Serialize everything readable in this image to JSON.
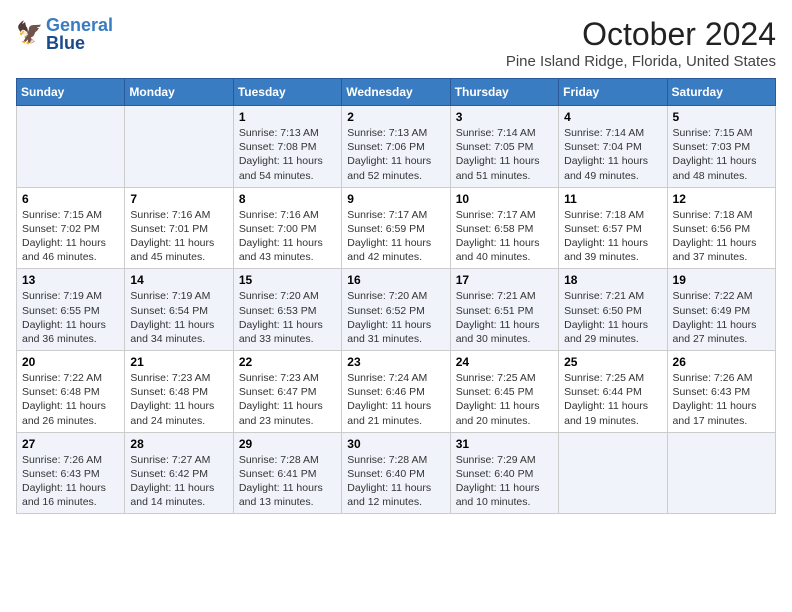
{
  "header": {
    "logo_general": "General",
    "logo_blue": "Blue",
    "month_title": "October 2024",
    "location": "Pine Island Ridge, Florida, United States"
  },
  "days_of_week": [
    "Sunday",
    "Monday",
    "Tuesday",
    "Wednesday",
    "Thursday",
    "Friday",
    "Saturday"
  ],
  "weeks": [
    [
      {
        "day": "",
        "info": ""
      },
      {
        "day": "",
        "info": ""
      },
      {
        "day": "1",
        "info": "Sunrise: 7:13 AM\nSunset: 7:08 PM\nDaylight: 11 hours and 54 minutes."
      },
      {
        "day": "2",
        "info": "Sunrise: 7:13 AM\nSunset: 7:06 PM\nDaylight: 11 hours and 52 minutes."
      },
      {
        "day": "3",
        "info": "Sunrise: 7:14 AM\nSunset: 7:05 PM\nDaylight: 11 hours and 51 minutes."
      },
      {
        "day": "4",
        "info": "Sunrise: 7:14 AM\nSunset: 7:04 PM\nDaylight: 11 hours and 49 minutes."
      },
      {
        "day": "5",
        "info": "Sunrise: 7:15 AM\nSunset: 7:03 PM\nDaylight: 11 hours and 48 minutes."
      }
    ],
    [
      {
        "day": "6",
        "info": "Sunrise: 7:15 AM\nSunset: 7:02 PM\nDaylight: 11 hours and 46 minutes."
      },
      {
        "day": "7",
        "info": "Sunrise: 7:16 AM\nSunset: 7:01 PM\nDaylight: 11 hours and 45 minutes."
      },
      {
        "day": "8",
        "info": "Sunrise: 7:16 AM\nSunset: 7:00 PM\nDaylight: 11 hours and 43 minutes."
      },
      {
        "day": "9",
        "info": "Sunrise: 7:17 AM\nSunset: 6:59 PM\nDaylight: 11 hours and 42 minutes."
      },
      {
        "day": "10",
        "info": "Sunrise: 7:17 AM\nSunset: 6:58 PM\nDaylight: 11 hours and 40 minutes."
      },
      {
        "day": "11",
        "info": "Sunrise: 7:18 AM\nSunset: 6:57 PM\nDaylight: 11 hours and 39 minutes."
      },
      {
        "day": "12",
        "info": "Sunrise: 7:18 AM\nSunset: 6:56 PM\nDaylight: 11 hours and 37 minutes."
      }
    ],
    [
      {
        "day": "13",
        "info": "Sunrise: 7:19 AM\nSunset: 6:55 PM\nDaylight: 11 hours and 36 minutes."
      },
      {
        "day": "14",
        "info": "Sunrise: 7:19 AM\nSunset: 6:54 PM\nDaylight: 11 hours and 34 minutes."
      },
      {
        "day": "15",
        "info": "Sunrise: 7:20 AM\nSunset: 6:53 PM\nDaylight: 11 hours and 33 minutes."
      },
      {
        "day": "16",
        "info": "Sunrise: 7:20 AM\nSunset: 6:52 PM\nDaylight: 11 hours and 31 minutes."
      },
      {
        "day": "17",
        "info": "Sunrise: 7:21 AM\nSunset: 6:51 PM\nDaylight: 11 hours and 30 minutes."
      },
      {
        "day": "18",
        "info": "Sunrise: 7:21 AM\nSunset: 6:50 PM\nDaylight: 11 hours and 29 minutes."
      },
      {
        "day": "19",
        "info": "Sunrise: 7:22 AM\nSunset: 6:49 PM\nDaylight: 11 hours and 27 minutes."
      }
    ],
    [
      {
        "day": "20",
        "info": "Sunrise: 7:22 AM\nSunset: 6:48 PM\nDaylight: 11 hours and 26 minutes."
      },
      {
        "day": "21",
        "info": "Sunrise: 7:23 AM\nSunset: 6:48 PM\nDaylight: 11 hours and 24 minutes."
      },
      {
        "day": "22",
        "info": "Sunrise: 7:23 AM\nSunset: 6:47 PM\nDaylight: 11 hours and 23 minutes."
      },
      {
        "day": "23",
        "info": "Sunrise: 7:24 AM\nSunset: 6:46 PM\nDaylight: 11 hours and 21 minutes."
      },
      {
        "day": "24",
        "info": "Sunrise: 7:25 AM\nSunset: 6:45 PM\nDaylight: 11 hours and 20 minutes."
      },
      {
        "day": "25",
        "info": "Sunrise: 7:25 AM\nSunset: 6:44 PM\nDaylight: 11 hours and 19 minutes."
      },
      {
        "day": "26",
        "info": "Sunrise: 7:26 AM\nSunset: 6:43 PM\nDaylight: 11 hours and 17 minutes."
      }
    ],
    [
      {
        "day": "27",
        "info": "Sunrise: 7:26 AM\nSunset: 6:43 PM\nDaylight: 11 hours and 16 minutes."
      },
      {
        "day": "28",
        "info": "Sunrise: 7:27 AM\nSunset: 6:42 PM\nDaylight: 11 hours and 14 minutes."
      },
      {
        "day": "29",
        "info": "Sunrise: 7:28 AM\nSunset: 6:41 PM\nDaylight: 11 hours and 13 minutes."
      },
      {
        "day": "30",
        "info": "Sunrise: 7:28 AM\nSunset: 6:40 PM\nDaylight: 11 hours and 12 minutes."
      },
      {
        "day": "31",
        "info": "Sunrise: 7:29 AM\nSunset: 6:40 PM\nDaylight: 11 hours and 10 minutes."
      },
      {
        "day": "",
        "info": ""
      },
      {
        "day": "",
        "info": ""
      }
    ]
  ]
}
